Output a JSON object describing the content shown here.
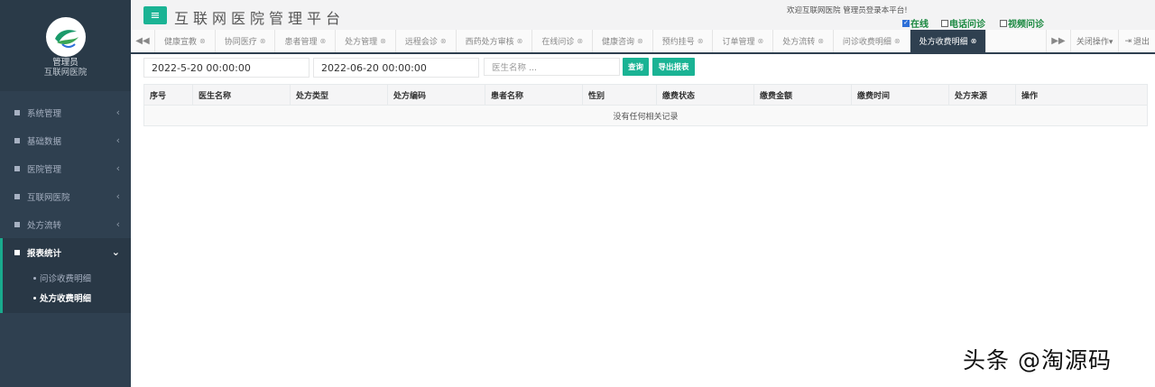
{
  "profile": {
    "role": "管理员",
    "org": "互联网医院",
    "logo_icon": "leaf-logo"
  },
  "header": {
    "title": "互联网医院管理平台",
    "menu_icon": "hamburger-icon",
    "welcome": "欢迎互联网医院 管理员登录本平台!",
    "status": [
      {
        "label": "在线",
        "checked": true
      },
      {
        "label": "电话问诊",
        "checked": false
      },
      {
        "label": "视频问诊",
        "checked": false
      }
    ]
  },
  "sidebar": {
    "items": [
      {
        "label": "系统管理",
        "icon": "bars-icon"
      },
      {
        "label": "基础数据",
        "icon": "square-icon"
      },
      {
        "label": "医院管理",
        "icon": "square-icon"
      },
      {
        "label": "互联网医院",
        "icon": "square-icon"
      },
      {
        "label": "处方流转",
        "icon": "square-icon"
      }
    ],
    "active_group": {
      "label": "报表统计",
      "children": [
        "问诊收费明细",
        "处方收费明细"
      ]
    }
  },
  "tabs": {
    "items": [
      "健康宣教",
      "协同医疗",
      "患者管理",
      "处方管理",
      "远程会诊",
      "西药处方审核",
      "在线问诊",
      "健康咨询",
      "预约挂号",
      "订单管理",
      "处方流转",
      "问诊收费明细",
      "处方收费明细"
    ],
    "active": "处方收费明细",
    "close_ops": "关闭操作▾",
    "logout": "退出"
  },
  "filter": {
    "start": "2022-5-20 00:00:00",
    "end": "2022-06-20 00:00:00",
    "doctor_placeholder": "医生名称 ...",
    "query": "查询",
    "export": "导出报表"
  },
  "table": {
    "columns": [
      "序号",
      "医生名称",
      "处方类型",
      "处方编码",
      "患者名称",
      "性别",
      "缴费状态",
      "缴费金额",
      "缴费时间",
      "处方来源",
      "操作"
    ],
    "empty": "没有任何相关记录"
  },
  "watermark": "头条 @淘源码"
}
